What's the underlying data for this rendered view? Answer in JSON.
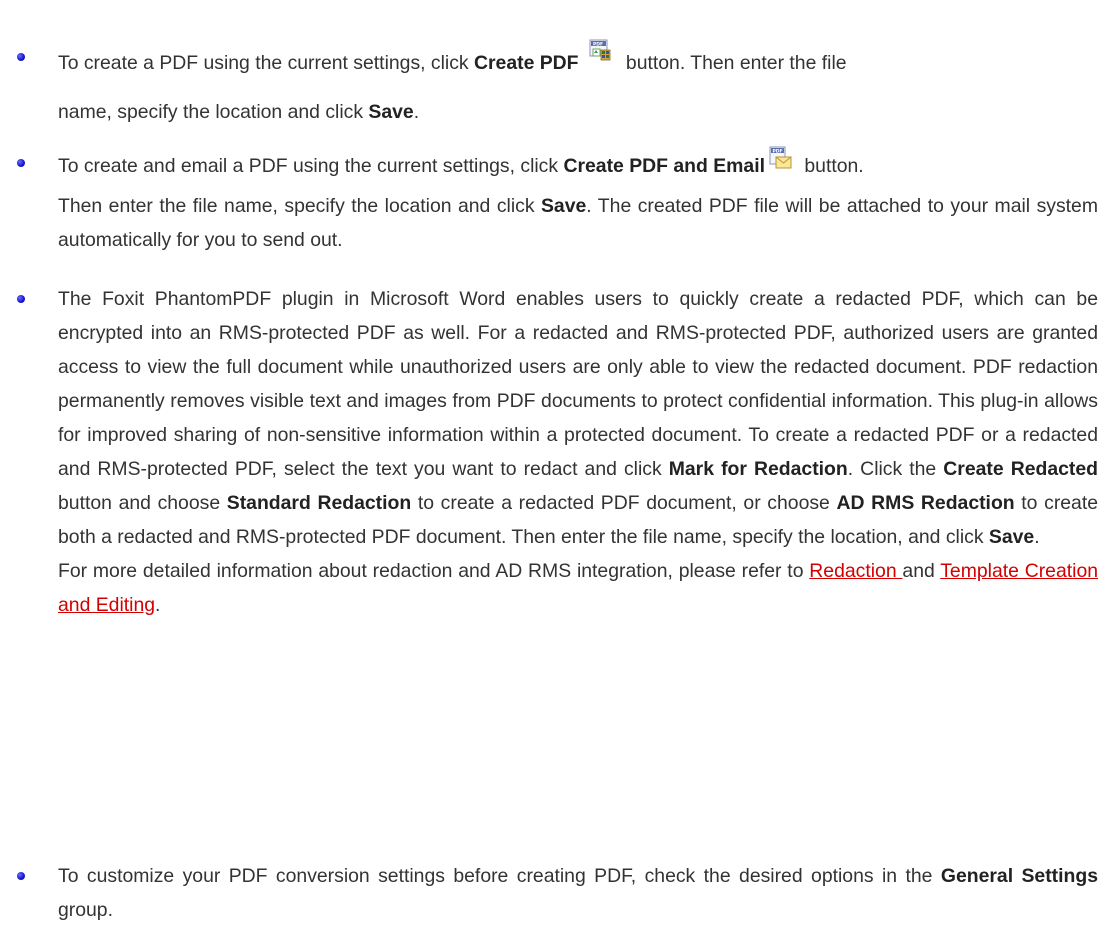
{
  "bullets": [
    {
      "part1": "To create a PDF using the current settings, click ",
      "bold1": "Create PDF",
      "icon": "create-pdf-icon",
      "part2": " button. Then enter the file",
      "line2a": "name, specify the location and click ",
      "bold2": "Save",
      "line2b": "."
    },
    {
      "part1": "To create and email a PDF using the current settings, click ",
      "bold1": "Create PDF and Email",
      "icon": "create-pdf-email-icon",
      "part2": " button.",
      "line2a": "Then enter the file name, specify the location and click ",
      "bold2": "Save",
      "line2b": ". The created PDF file will be attached to your mail system automatically for you to send out."
    },
    {
      "text1": "The Foxit PhantomPDF plugin in Microsoft Word enables users to quickly create a redacted PDF, which can be encrypted into an RMS-protected PDF as well. For a redacted and RMS-protected PDF, authorized users are granted access to view the full document while unauthorized users are only able to view the redacted document. PDF redaction permanently removes visible text and images from PDF documents to protect confidential information. This plug-in allows for improved sharing of non-sensitive information within a protected document. To create a redacted PDF or a redacted and RMS-protected PDF, select the text you want to redact and click ",
      "bold1": "Mark for Redaction",
      "text2": ". Click the ",
      "bold2": "Create Redacted",
      "text3": " button and choose ",
      "bold3": "Standard Redaction",
      "text4": " to create a redacted PDF document, or choose ",
      "bold4": "AD RMS Redaction",
      "text5": " to create both a redacted and RMS-protected PDF document. Then enter the file name, specify the location, and click ",
      "bold5": "Save",
      "text6": ".",
      "more_text1": "For more detailed information about redaction and AD RMS integration, please refer to ",
      "link1": "Redaction ",
      "more_text2": "and ",
      "link2": "Template Creation and Editing",
      "more_text3": "."
    },
    {
      "text1": "To customize your PDF conversion settings before creating PDF, check the desired options in the ",
      "bold1": "General Settings",
      "text2": " group."
    }
  ],
  "colors": {
    "text": "#333333",
    "link": "#d40000",
    "bullet": "#1a1ad0"
  }
}
